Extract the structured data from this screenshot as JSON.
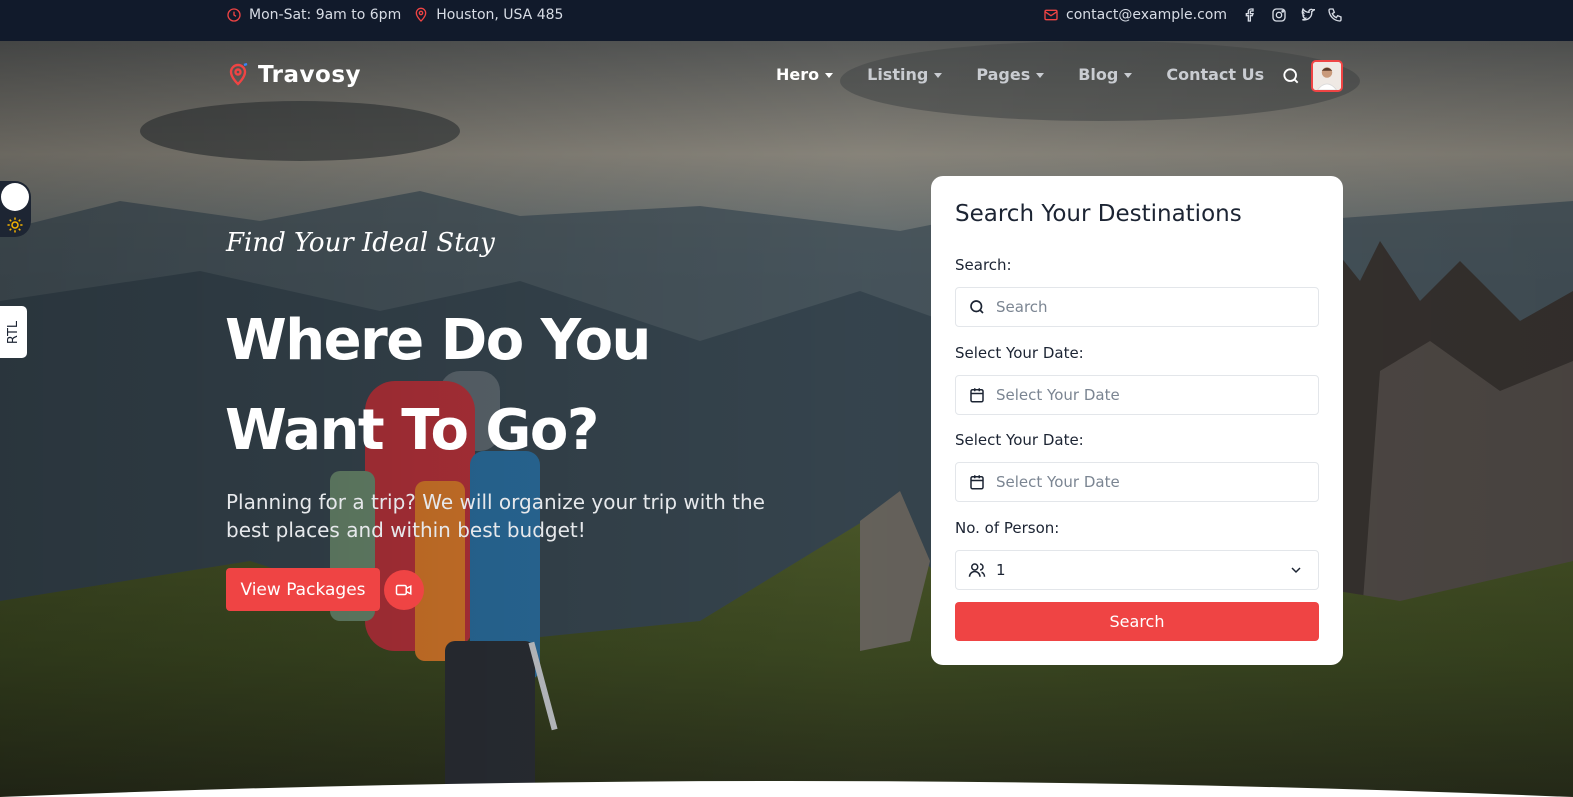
{
  "topbar": {
    "hours": "Mon-Sat: 9am to 6pm",
    "location": "Houston, USA 485",
    "email": "contact@example.com",
    "social": [
      "facebook-icon",
      "instagram-icon",
      "twitter-icon",
      "phone-icon"
    ]
  },
  "brand": {
    "name": "Travosy",
    "accent": "#ef4444"
  },
  "nav": {
    "items": [
      {
        "label": "Hero",
        "dropdown": true,
        "active": true
      },
      {
        "label": "Listing",
        "dropdown": true,
        "active": false
      },
      {
        "label": "Pages",
        "dropdown": true,
        "active": false
      },
      {
        "label": "Blog",
        "dropdown": true,
        "active": false
      },
      {
        "label": "Contact Us",
        "dropdown": false,
        "active": false
      }
    ]
  },
  "side": {
    "rtl_label": "RTL"
  },
  "hero": {
    "tagline": "Find Your Ideal Stay",
    "headline_line1": "Where Do You",
    "headline_line2": "Want To Go?",
    "description": "Planning for a trip? We will organize your trip with the best places and within best budget!",
    "cta_label": "View Packages"
  },
  "search_card": {
    "title": "Search Your Destinations",
    "search_label": "Search:",
    "search_placeholder": "Search",
    "date1_label": "Select Your Date:",
    "date1_placeholder": "Select Your Date",
    "date2_label": "Select Your Date:",
    "date2_placeholder": "Select Your Date",
    "persons_label": "No. of Person:",
    "persons_value": "1",
    "submit_label": "Search"
  }
}
